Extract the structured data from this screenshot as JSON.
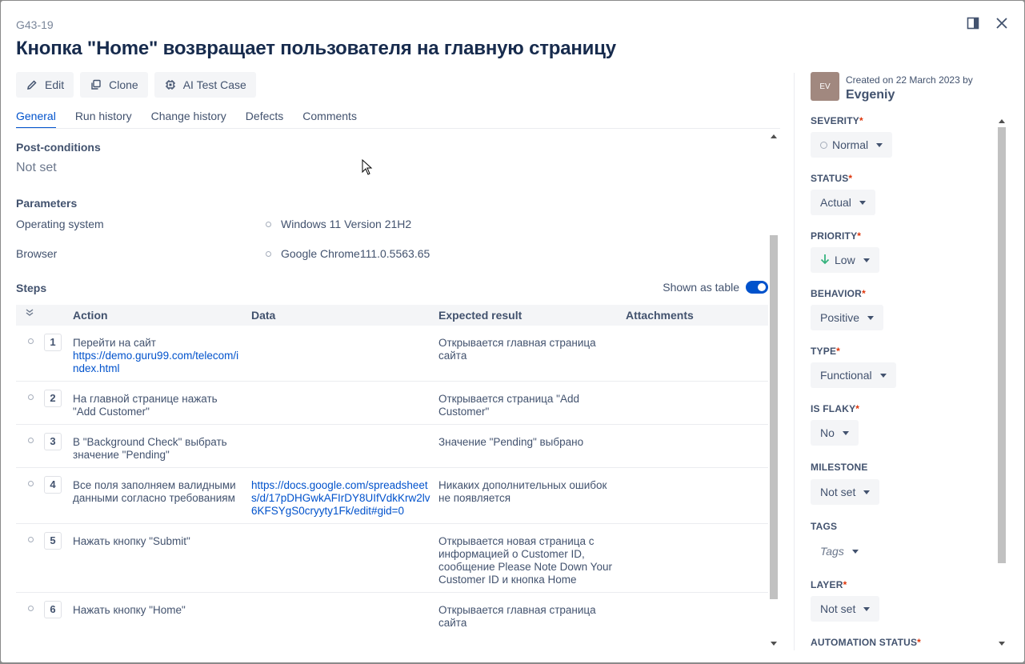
{
  "header": {
    "issue_key": "G43-19",
    "title": "Кнопка \"Home\" возвращает пользователя на главную страницу"
  },
  "actions": {
    "edit": "Edit",
    "clone": "Clone",
    "ai": "AI Test Case"
  },
  "tabs": [
    "General",
    "Run history",
    "Change history",
    "Defects",
    "Comments"
  ],
  "content": {
    "postconditions_title": "Post-conditions",
    "postconditions_value": "Not set",
    "parameters_title": "Parameters",
    "params": [
      {
        "label": "Operating system",
        "value": "Windows 11 Version 21H2"
      },
      {
        "label": "Browser",
        "value": "Google Chrome111.0.5563.65"
      }
    ],
    "steps_title": "Steps",
    "shown_as_table": "Shown as table"
  },
  "table": {
    "headers": {
      "action": "Action",
      "data": "Data",
      "expected": "Expected result",
      "attachments": "Attachments"
    },
    "rows": [
      {
        "num": "1",
        "action": "Перейти на сайт",
        "action_link": "https://demo.guru99.com/telecom/index.html",
        "data": "",
        "expected": "Открывается главная страница сайта"
      },
      {
        "num": "2",
        "action": "На главной странице нажать \"Add Customer\"",
        "action_link": "",
        "data": "",
        "expected": "Открывается страница \"Add Customer\""
      },
      {
        "num": "3",
        "action": "В \"Background Check\" выбрать значение \"Pending\"",
        "action_link": "",
        "data": "",
        "expected": "Значение \"Pending\" выбрано"
      },
      {
        "num": "4",
        "action": "Все поля заполняем валидными данными согласно требованиям",
        "action_link": "",
        "data": "https://docs.google.com/spreadsheets/d/17pDHGwkAFIrDY8UIfVdkKrw2lv6KFSYgS0cryyty1Fk/edit#gid=0",
        "expected": "Никаких дополнительных ошибок не появляется"
      },
      {
        "num": "5",
        "action": "Нажать кнопку \"Submit\"",
        "action_link": "",
        "data": "",
        "expected": "Открывается новая страница с информацией о Customer ID, сообщение Please Note Down Your Customer ID и кнопка Home"
      },
      {
        "num": "6",
        "action": "Нажать кнопку \"Home\"",
        "action_link": "",
        "data": "",
        "expected": "Открывается главная страница сайта"
      }
    ]
  },
  "sidebar": {
    "avatar": "EV",
    "created_text": "Created on 22 March 2023 by",
    "created_by": "Evgeniy",
    "fields": {
      "severity": {
        "label": "SEVERITY",
        "value": "Normal"
      },
      "status": {
        "label": "STATUS",
        "value": "Actual"
      },
      "priority": {
        "label": "PRIORITY",
        "value": "Low"
      },
      "behavior": {
        "label": "BEHAVIOR",
        "value": "Positive"
      },
      "type": {
        "label": "TYPE",
        "value": "Functional"
      },
      "flaky": {
        "label": "IS FLAKY",
        "value": "No"
      },
      "milestone": {
        "label": "MILESTONE",
        "value": "Not set"
      },
      "tags": {
        "label": "TAGS",
        "value": "Tags"
      },
      "layer": {
        "label": "LAYER",
        "value": "Not set"
      },
      "automation": {
        "label": "AUTOMATION STATUS"
      }
    }
  },
  "colors": {
    "accent": "#0052cc",
    "priority_low": "#36b37e",
    "required": "#de350b"
  }
}
